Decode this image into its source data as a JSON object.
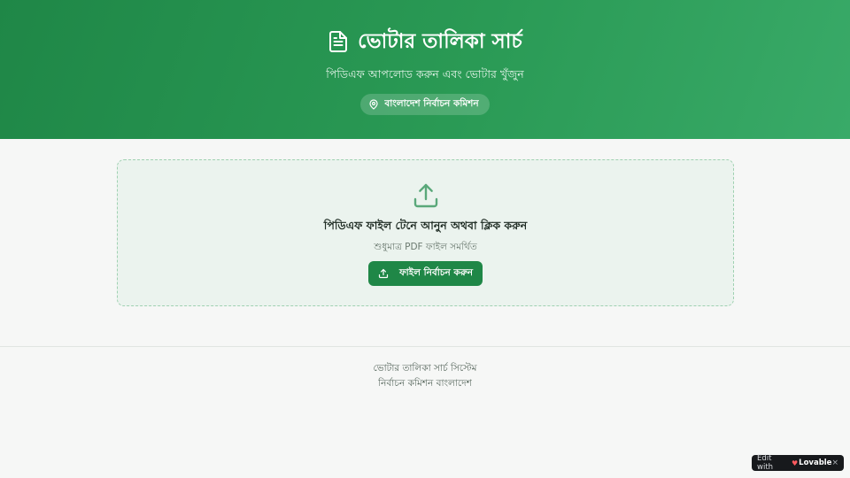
{
  "header": {
    "title": "ভোটার তালিকা সার্চ",
    "subtitle": "পিডিএফ আপলোড করুন এবং ভোটার খুঁজুন",
    "badge": "বাংলাদেশ নির্বাচন কমিশন",
    "title_icon": "document-icon",
    "badge_icon": "location-pin-icon"
  },
  "upload": {
    "title": "পিডিএফ ফাইল টেনে আনুন অথবা ক্লিক করুন",
    "hint": "শুধুমাত্র PDF ফাইল সমর্থিত",
    "button_label": "ফাইল নির্বাচন করুন",
    "icon": "upload-icon"
  },
  "footer": {
    "line1": "ভোটার তালিকা সার্চ সিস্টেম",
    "line2": "নির্বাচন কমিশন বাংলাদেশ"
  },
  "lovable_badge": {
    "prefix": "Edit with",
    "brand": "Lovable",
    "close": "×"
  },
  "colors": {
    "primary": "#1f8747",
    "header_gradient_end": "#39aa68",
    "dropzone_bg": "#ebf3ee",
    "dropzone_border": "#9fd1b1",
    "page_bg": "#f6f7f6"
  }
}
